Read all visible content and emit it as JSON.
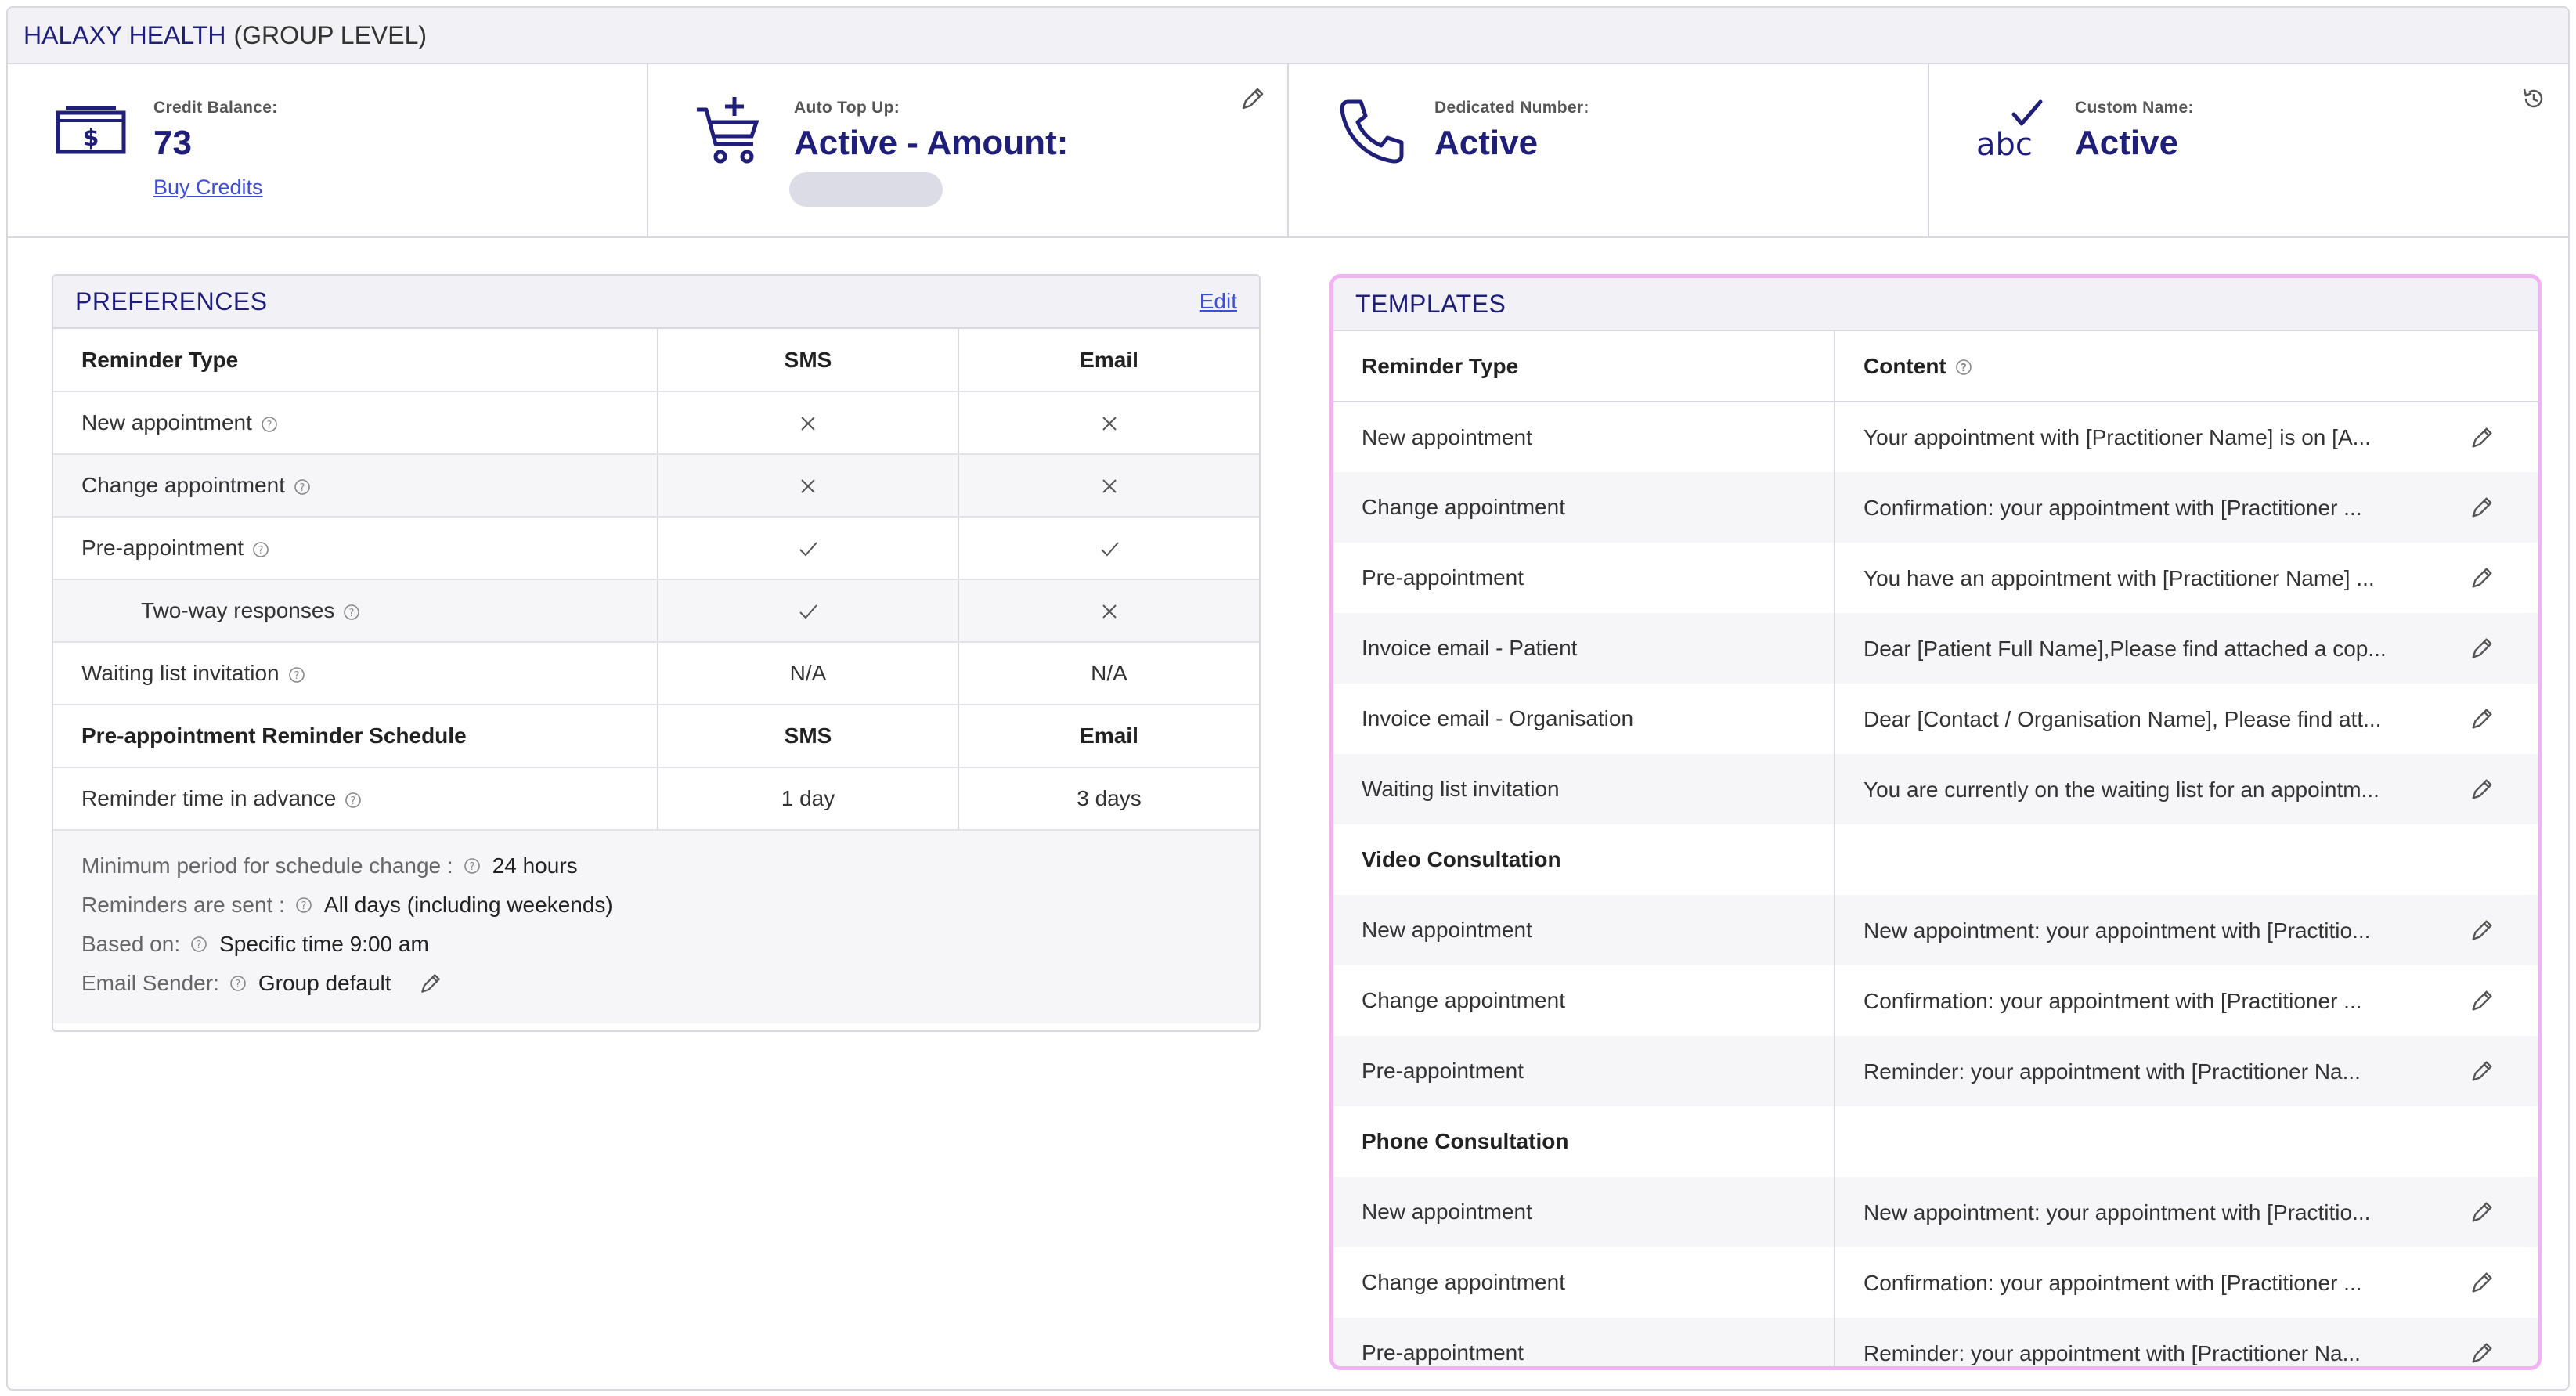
{
  "header": {
    "org": "HALAXY HEALTH",
    "level": "(GROUP LEVEL)"
  },
  "stats": {
    "credit": {
      "label": "Credit Balance:",
      "value": "73",
      "link": "Buy Credits",
      "icon": "money-icon"
    },
    "topup": {
      "label": "Auto Top Up:",
      "value": "Active - Amount:",
      "icon": "cart-plus-icon"
    },
    "dedicated": {
      "label": "Dedicated Number:",
      "value": "Active",
      "icon": "phone-icon"
    },
    "custom": {
      "label": "Custom Name:",
      "value": "Active",
      "icon_text": "abc",
      "icon": "abc-check-icon"
    }
  },
  "preferences": {
    "title": "PREFERENCES",
    "edit": "Edit",
    "headers": [
      "Reminder Type",
      "SMS",
      "Email"
    ],
    "rows": [
      {
        "label": "New appointment",
        "sms": "x",
        "email": "x"
      },
      {
        "label": "Change appointment",
        "sms": "x",
        "email": "x"
      },
      {
        "label": "Pre-appointment",
        "sms": "check",
        "email": "check"
      },
      {
        "label": "Two-way responses",
        "sms": "check",
        "email": "x"
      },
      {
        "label": "Waiting list invitation",
        "sms": "N/A",
        "email": "N/A"
      }
    ],
    "schedule_headers": [
      "Pre-appointment Reminder Schedule",
      "SMS",
      "Email"
    ],
    "schedule_row": {
      "label": "Reminder time in advance",
      "sms": "1 day",
      "email": "3 days"
    },
    "footer": {
      "min_period_label": "Minimum period for schedule change :",
      "min_period_value": "24 hours",
      "sent_label": "Reminders are sent :",
      "sent_value": "All days (including weekends)",
      "based_label": "Based on:",
      "based_value": "Specific time 9:00 am",
      "sender_label": "Email Sender:",
      "sender_value": "Group default"
    }
  },
  "templates": {
    "title": "TEMPLATES",
    "headers": [
      "Reminder Type",
      "Content"
    ],
    "rows": [
      {
        "type": "New appointment",
        "content": "Your appointment with [Practitioner Name] is on [A..."
      },
      {
        "type": "Change appointment",
        "content": "Confirmation: your appointment with [Practitioner ..."
      },
      {
        "type": "Pre-appointment",
        "content": "You have an appointment with [Practitioner Name] ..."
      },
      {
        "type": "Invoice email - Patient",
        "content": "Dear [Patient Full Name],Please find attached a cop..."
      },
      {
        "type": "Invoice email - Organisation",
        "content": "Dear [Contact / Organisation Name], Please find att..."
      },
      {
        "type": "Waiting list invitation",
        "content": "You are currently on the waiting list for an appointm..."
      }
    ],
    "video_group": "Video Consultation",
    "video_rows": [
      {
        "type": "New appointment",
        "content": "New appointment: your appointment with [Practitio..."
      },
      {
        "type": "Change appointment",
        "content": "Confirmation: your appointment with [Practitioner ..."
      },
      {
        "type": "Pre-appointment",
        "content": "Reminder: your appointment with [Practitioner Na..."
      }
    ],
    "phone_group": "Phone Consultation",
    "phone_rows": [
      {
        "type": "New appointment",
        "content": "New appointment: your appointment with [Practitio..."
      },
      {
        "type": "Change appointment",
        "content": "Confirmation: your appointment with [Practitioner ..."
      },
      {
        "type": "Pre-appointment",
        "content": "Reminder: your appointment with [Practitioner Na..."
      }
    ]
  },
  "colors": {
    "accent": "#1f1f7a",
    "link": "#3d4fd6",
    "highlight": "#f0b4f2"
  }
}
